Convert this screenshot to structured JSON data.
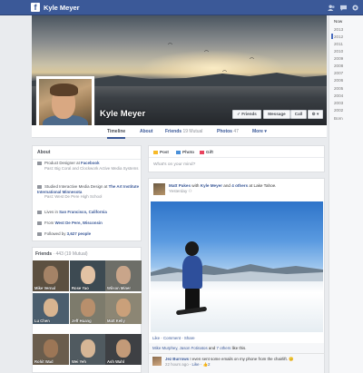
{
  "topbar": {
    "logo": "f",
    "name": "Kyle Meyer",
    "icons": [
      "friend-requests-icon",
      "messages-icon",
      "notifications-icon"
    ]
  },
  "years": [
    "Now",
    "2013",
    "2012",
    "2011",
    "2010",
    "2009",
    "2008",
    "2007",
    "2006",
    "2005",
    "2004",
    "2003",
    "2002",
    "Born"
  ],
  "profile": {
    "name": "Kyle Meyer",
    "friends_button": "✓ Friends",
    "message_button": "Message",
    "call_button": "Call",
    "more_button": "⚙ ▾"
  },
  "nav": {
    "timeline": "Timeline",
    "about": "About",
    "friends": "Friends",
    "friends_count": "19 Mutual",
    "photos": "Photos",
    "photos_count": "47",
    "more": "More ▾"
  },
  "about": {
    "title": "About",
    "work": {
      "role": "Product Designer at",
      "company": "Facebook",
      "sub": "Past: Big Coral and Clockwork Active Media Systems"
    },
    "study": {
      "prefix": "Studied Interactive Media Design at",
      "school": "The Art Institute International Minnesota",
      "sub": "Past: West De Pere High School"
    },
    "lives": {
      "prefix": "Lives in",
      "place": "San Francisco, California"
    },
    "from": {
      "prefix": "From",
      "place": "West De Pere, Wisconsin"
    },
    "followed": {
      "prefix": "Followed by",
      "count": "3,627 people"
    }
  },
  "friends": {
    "title": "Friends",
    "count": "· 443 (19 Mutual)",
    "list": [
      "Mike Vernal",
      "Rose Yao",
      "Wilson Miner",
      "Lu Chen",
      "Jeff Huang",
      "Matt Kelly",
      "Rohit Wad",
      "Wei Yeh",
      "Ash Wahl"
    ]
  },
  "composer": {
    "post": "Post",
    "photo": "Photo",
    "gift": "Gift",
    "placeholder": "What's on your mind?"
  },
  "post": {
    "author": "Matt Pakes",
    "with_text": "with",
    "friend": "Kyle Meyer",
    "and_text": "and",
    "others": "4 others",
    "at_text": "at Lake Tahoe.",
    "time": "Yesterday",
    "actions": [
      "Like",
      "Comment",
      "Share"
    ],
    "likes": {
      "names": "Mike Murphey, Jason Fotinatos",
      "and_text": "and",
      "others": "7 others",
      "suffix": "like this."
    },
    "comment": {
      "author": "Jez Burrows",
      "text": "I even sent some emails on my phone from the chairlift. 😊",
      "time": "22 hours ago",
      "like": "Like",
      "likes": "👍2"
    }
  }
}
